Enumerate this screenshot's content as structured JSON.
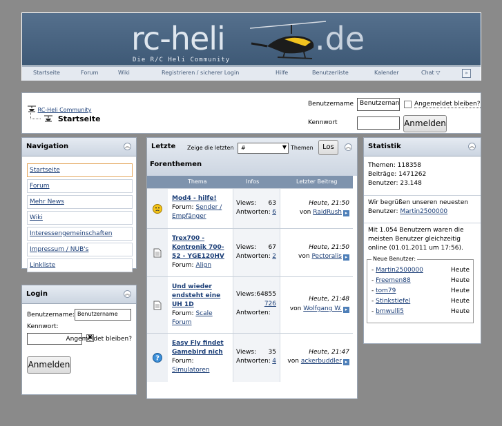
{
  "header": {
    "logo_main": "rc-heli",
    "logo_tld": ".de",
    "logo_sub": "Die R/C Heli Community",
    "nav": [
      "Startseite",
      "Forum",
      "Wiki",
      "Registrieren / sicherer Login",
      "Hilfe",
      "Benutzerliste",
      "Kalender",
      "Chat"
    ],
    "nav_end": "»"
  },
  "breadcrumb": {
    "home": "RC-Heli Community",
    "current": "Startseite"
  },
  "login_bar": {
    "username_label": "Benutzername",
    "username_value": "Benutzernan",
    "password_label": "Kennwort",
    "remember_label": "Angemeldet bleiben?",
    "submit": "Anmelden"
  },
  "navigation": {
    "title": "Navigation",
    "items": [
      "Startseite",
      "Forum",
      "Mehr News",
      "Wiki",
      "Interessengemeinschaften",
      "Impressum / NUB's",
      "Linkliste"
    ]
  },
  "login_panel": {
    "title": "Login",
    "username_label": "Benutzername:",
    "username_value": "Benutzername",
    "password_label": "Kennwort:",
    "remember_label": "Angemeldet bleiben?",
    "submit": "Anmelden"
  },
  "latest": {
    "title": "Letzte",
    "title2": "Forenthemen",
    "show_label": "Zeige die letzten",
    "select_value": "#",
    "themes_label": "Themen",
    "go": "Los",
    "columns": [
      "Thema",
      "Infos",
      "Letzter Beitrag"
    ],
    "rows": [
      {
        "title": "Mod4 - hilfe!",
        "forum_label": "Forum:",
        "forum": "Sender / Empfänger",
        "views_label": "Views:",
        "views": "63",
        "replies_label": "Antworten:",
        "replies": "6",
        "time": "Heute, 21:50",
        "by": "von",
        "user": "RaidRush"
      },
      {
        "title": "Trex700 - Kontronik 700-52 - YGE120HV",
        "forum_label": "Forum:",
        "forum": "Align",
        "views_label": "Views:",
        "views": "67",
        "replies_label": "Antworten:",
        "replies": "2",
        "time": "Heute, 21:50",
        "by": "von",
        "user": "Pectoralis"
      },
      {
        "title": "Und wieder endsteht eine UH 1D",
        "forum_label": "Forum:",
        "forum": "Scale Forum",
        "views_label": "Views:",
        "views": "64855",
        "replies_label": "Antworten:",
        "replies": "726",
        "time": "Heute, 21:48",
        "by": "von",
        "user": "Wolfgang W."
      },
      {
        "title": "Easy Fly findet Gamebird nich",
        "forum_label": "Forum:",
        "forum": "Simulatoren",
        "views_label": "Views:",
        "views": "35",
        "replies_label": "Antworten:",
        "replies": "4",
        "time": "Heute, 21:47",
        "by": "von",
        "user": "ackerbuddler"
      }
    ]
  },
  "stats": {
    "title": "Statistik",
    "themes": "Themen: 118358",
    "posts": "Beiträge: 1471262",
    "users": "Benutzer: 23.148",
    "welcome": "Wir begrüßen unseren neuesten Benutzer:",
    "newest": "Martin2500000",
    "record": "Mit 1.054 Benutzern waren die meisten Benutzer gleichzeitig online (01.01.2011 um 17:56).",
    "new_users_legend": "Neue Benutzer:",
    "new_users": [
      {
        "name": "Martin2500000",
        "date": "Heute"
      },
      {
        "name": "Freemen88",
        "date": "Heute"
      },
      {
        "name": "tom79",
        "date": "Heute"
      },
      {
        "name": "Stinkstiefel",
        "date": "Heute"
      },
      {
        "name": "bmwulli5",
        "date": "Heute"
      }
    ]
  }
}
